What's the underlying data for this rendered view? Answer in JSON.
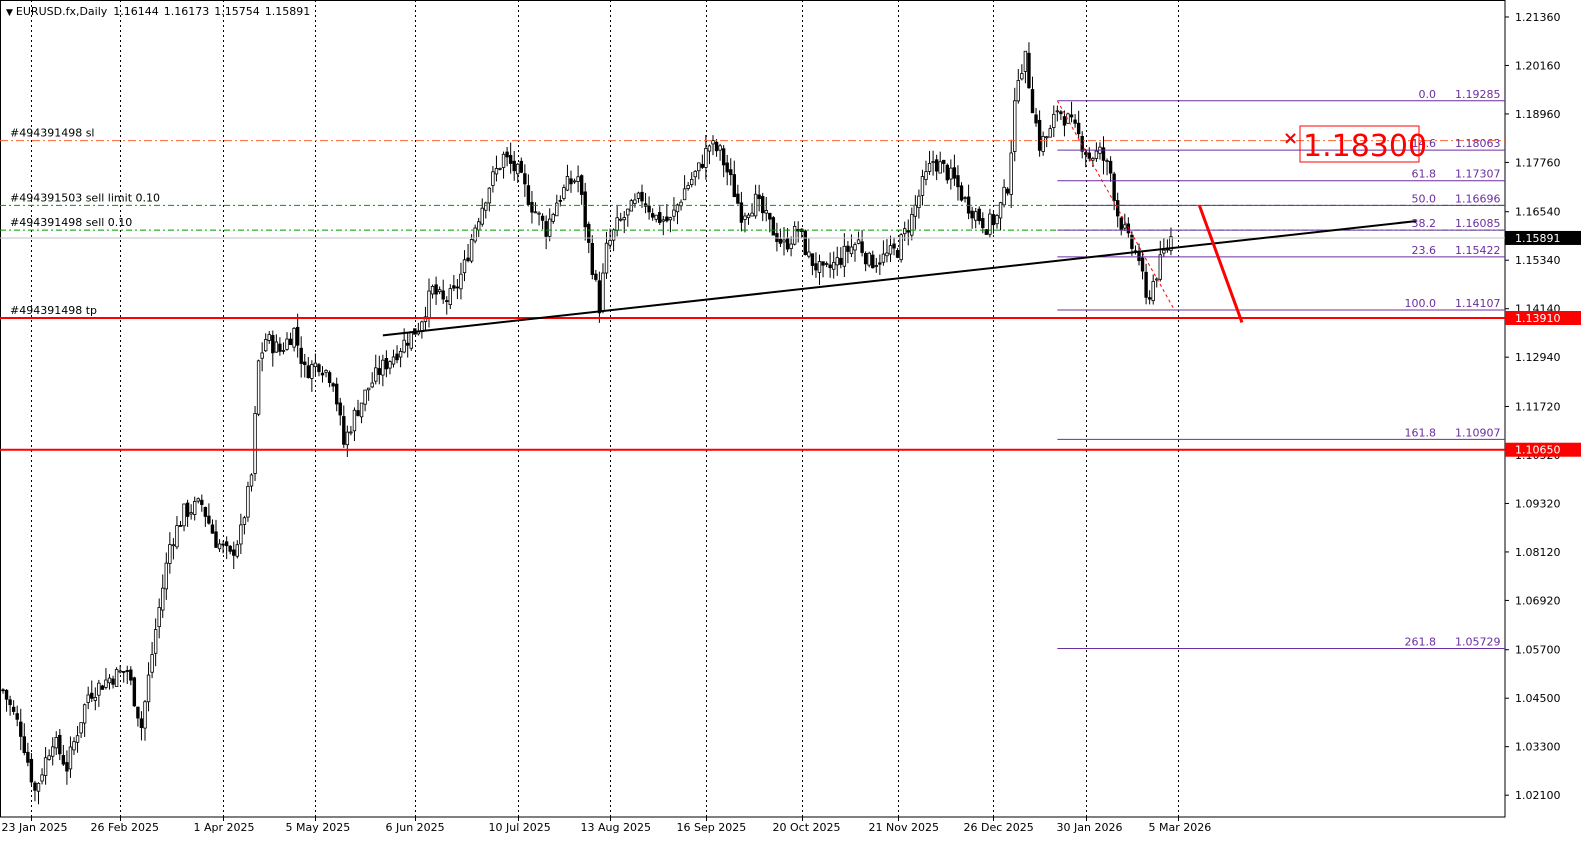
{
  "header": {
    "symbol": "EURUSD.fx,Daily",
    "open": "1.16144",
    "high": "1.16173",
    "low": "1.15754",
    "close": "1.15891"
  },
  "chart_data": {
    "type": "candlestick",
    "ylim": [
      1.0156,
      1.2178
    ],
    "y_ticks": [
      "1.21360",
      "1.20160",
      "1.18960",
      "1.17760",
      "1.16540",
      "1.15340",
      "1.14140",
      "1.12940",
      "1.11720",
      "1.10520",
      "1.09320",
      "1.08120",
      "1.06920",
      "1.05700",
      "1.04500",
      "1.03300",
      "1.02100"
    ],
    "x_ticks": [
      "23 Jan 2025",
      "26 Feb 2025",
      "1 Apr 2025",
      "5 May 2025",
      "6 Jun 2025",
      "10 Jul 2025",
      "13 Aug 2025",
      "16 Sep 2025",
      "20 Oct 2025",
      "21 Nov 2025",
      "26 Dec 2025",
      "30 Jan 2026",
      "5 Mar 2026"
    ],
    "price_path": [
      [
        0,
        1.047
      ],
      [
        5,
        1.037
      ],
      [
        9,
        1.022
      ],
      [
        14,
        1.035
      ],
      [
        18,
        1.028
      ],
      [
        24,
        1.046
      ],
      [
        30,
        1.05
      ],
      [
        35,
        1.052
      ],
      [
        39,
        1.038
      ],
      [
        43,
        1.062
      ],
      [
        47,
        1.083
      ],
      [
        51,
        1.091
      ],
      [
        56,
        1.093
      ],
      [
        60,
        1.084
      ],
      [
        64,
        1.08
      ],
      [
        67,
        1.086
      ],
      [
        70,
        1.1
      ],
      [
        72,
        1.128
      ],
      [
        74,
        1.134
      ],
      [
        78,
        1.131
      ],
      [
        82,
        1.136
      ],
      [
        85,
        1.126
      ],
      [
        89,
        1.128
      ],
      [
        93,
        1.124
      ],
      [
        96,
        1.108
      ],
      [
        99,
        1.115
      ],
      [
        103,
        1.122
      ],
      [
        106,
        1.126
      ],
      [
        109,
        1.129
      ],
      [
        113,
        1.133
      ],
      [
        117,
        1.137
      ],
      [
        121,
        1.146
      ],
      [
        124,
        1.143
      ],
      [
        127,
        1.145
      ],
      [
        130,
        1.152
      ],
      [
        133,
        1.162
      ],
      [
        137,
        1.172
      ],
      [
        141,
        1.179
      ],
      [
        145,
        1.175
      ],
      [
        149,
        1.167
      ],
      [
        153,
        1.161
      ],
      [
        156,
        1.168
      ],
      [
        159,
        1.172
      ],
      [
        162,
        1.174
      ],
      [
        165,
        1.157
      ],
      [
        168,
        1.142
      ],
      [
        170,
        1.156
      ],
      [
        173,
        1.162
      ],
      [
        177,
        1.166
      ],
      [
        180,
        1.169
      ],
      [
        184,
        1.164
      ],
      [
        188,
        1.163
      ],
      [
        192,
        1.171
      ],
      [
        196,
        1.176
      ],
      [
        199,
        1.182
      ],
      [
        202,
        1.18
      ],
      [
        205,
        1.173
      ],
      [
        208,
        1.165
      ],
      [
        212,
        1.168
      ],
      [
        216,
        1.162
      ],
      [
        220,
        1.157
      ],
      [
        224,
        1.161
      ],
      [
        227,
        1.154
      ],
      [
        231,
        1.15
      ],
      [
        235,
        1.153
      ],
      [
        238,
        1.156
      ],
      [
        241,
        1.158
      ],
      [
        244,
        1.153
      ],
      [
        248,
        1.154
      ],
      [
        252,
        1.156
      ],
      [
        256,
        1.164
      ],
      [
        259,
        1.172
      ],
      [
        262,
        1.178
      ],
      [
        265,
        1.176
      ],
      [
        268,
        1.173
      ],
      [
        271,
        1.168
      ],
      [
        274,
        1.165
      ],
      [
        277,
        1.162
      ],
      [
        280,
        1.164
      ],
      [
        283,
        1.172
      ],
      [
        286,
        1.2
      ],
      [
        288,
        1.203
      ],
      [
        290,
        1.192
      ],
      [
        292,
        1.182
      ],
      [
        295,
        1.185
      ],
      [
        297,
        1.191
      ],
      [
        300,
        1.188
      ],
      [
        303,
        1.184
      ],
      [
        306,
        1.179
      ],
      [
        309,
        1.18
      ],
      [
        312,
        1.175
      ],
      [
        314,
        1.165
      ],
      [
        317,
        1.158
      ],
      [
        320,
        1.154
      ],
      [
        322,
        1.143
      ],
      [
        324,
        1.148
      ],
      [
        327,
        1.155
      ],
      [
        329,
        1.159
      ]
    ],
    "levels": [
      {
        "label": "#494391498 sl",
        "value": 1.183
      },
      {
        "label": "#494391503 sell limit 0.10",
        "value": 1.16696
      },
      {
        "label": "#494391498 sell 0.10",
        "value": 1.16085
      },
      {
        "label": "#494391498 tp",
        "value": 1.1391
      }
    ],
    "horizontal_lines": [
      {
        "label": "1.13910",
        "value": 1.1391
      },
      {
        "label": "1.10650",
        "value": 1.1065
      }
    ],
    "current_price": "1.15891",
    "fibonacci": [
      {
        "ratio": "0.0",
        "price": "1.19285"
      },
      {
        "ratio": "14.6",
        "price": "1.18063"
      },
      {
        "ratio": "61.8",
        "price": "1.17307"
      },
      {
        "ratio": "50.0",
        "price": "1.16696"
      },
      {
        "ratio": "38.2",
        "price": "1.16085"
      },
      {
        "ratio": "23.6",
        "price": "1.15422"
      },
      {
        "ratio": "100.0",
        "price": "1.14107"
      },
      {
        "ratio": "161.8",
        "price": "1.10907"
      },
      {
        "ratio": "261.8",
        "price": "1.05729"
      }
    ],
    "sl_label": "1.18300",
    "colors": {
      "sl": "#ff6633",
      "pending": "#009900",
      "red": "#ff0000",
      "fib": "#6a2fa0",
      "candle": "#000000"
    }
  }
}
